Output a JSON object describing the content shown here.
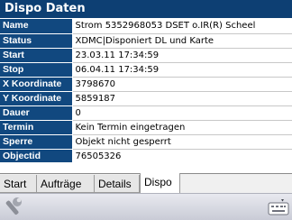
{
  "window": {
    "title": "Dispo Daten"
  },
  "fields": [
    {
      "label": "Name",
      "value": "Strom 5352968053 DSET o.IR(R) Scheel"
    },
    {
      "label": "Status",
      "value": "XDMC|Disponiert DL und Karte"
    },
    {
      "label": "Start",
      "value": "23.03.11 17:34:59"
    },
    {
      "label": "Stop",
      "value": "06.04.11 17:34:59"
    },
    {
      "label": "X Koordinate",
      "value": "3798670"
    },
    {
      "label": "Y Koordinate",
      "value": "5859187"
    },
    {
      "label": "Dauer",
      "value": "0"
    },
    {
      "label": "Termin",
      "value": "Kein Termin eingetragen"
    },
    {
      "label": "Sperre",
      "value": "Objekt nicht gesperrt"
    },
    {
      "label": "Objectid",
      "value": "76505326"
    }
  ],
  "tabs": [
    "Start",
    "Aufträge",
    "Details",
    "Dispo"
  ],
  "active_tab": "Dispo",
  "toolbar": {
    "left_icon": "tool-wrench-icon",
    "right_icon": "keyboard-icon"
  },
  "colors": {
    "title_bg": "#0d3f73",
    "label_bg": "#11487f"
  }
}
